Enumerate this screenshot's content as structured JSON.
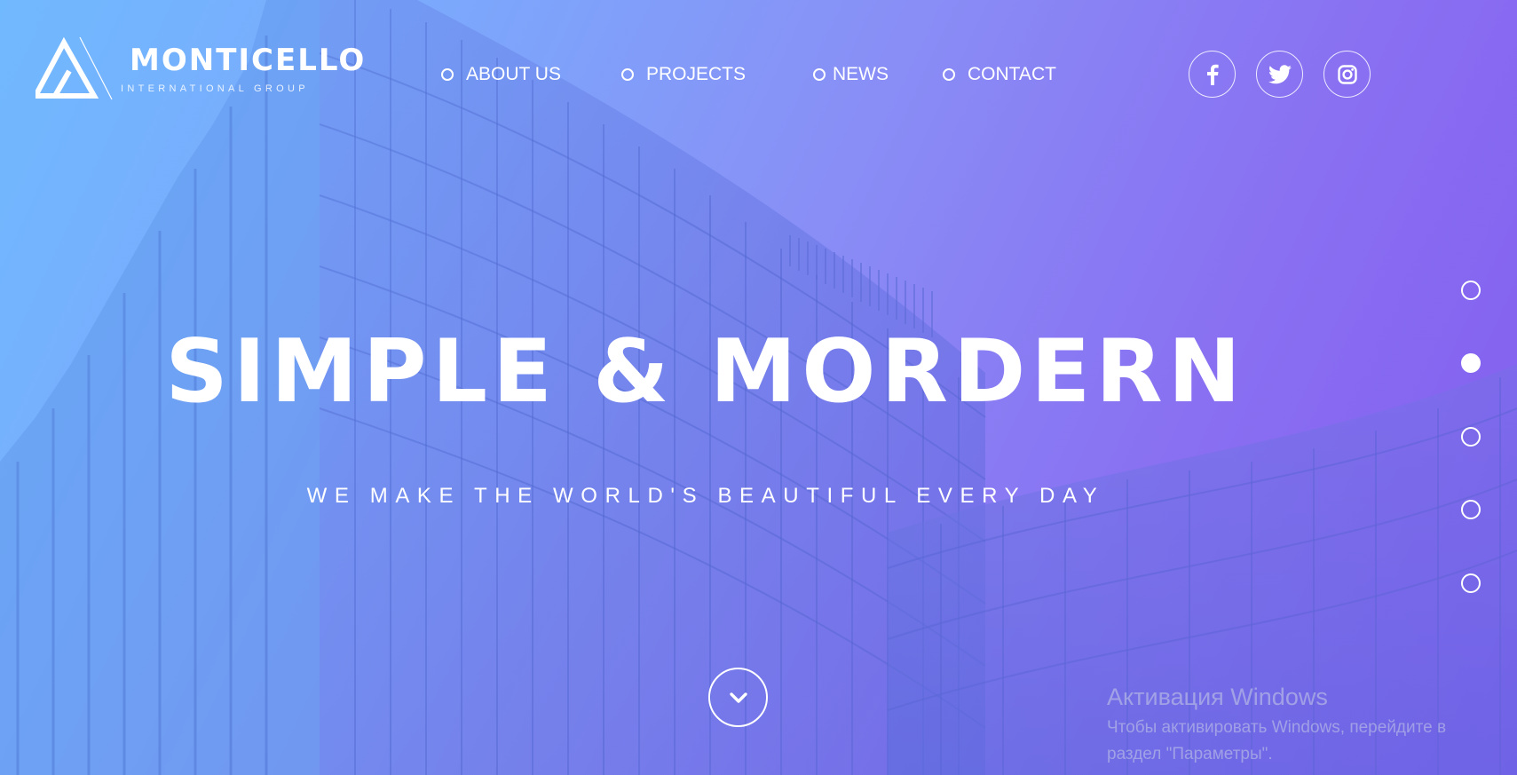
{
  "brand": {
    "name": "MONTICELLO",
    "subtitle": "INTERNATIONAL GROUP"
  },
  "nav": {
    "items": [
      {
        "label": "ABOUT US"
      },
      {
        "label": "PROJECTS"
      },
      {
        "label": "NEWS"
      },
      {
        "label": "CONTACT"
      }
    ]
  },
  "social": [
    {
      "icon": "facebook-icon"
    },
    {
      "icon": "twitter-icon"
    },
    {
      "icon": "instagram-icon"
    }
  ],
  "hero": {
    "headline": "SIMPLE & MORDERN",
    "tagline": "WE MAKE THE WORLD'S BEAUTIFUL EVERY DAY",
    "scroll_icon": "chevron-down-icon"
  },
  "pager": {
    "count": 5,
    "active_index": 1
  },
  "watermark": {
    "title": "Активация Windows",
    "line1": "Чтобы активировать Windows, перейдите в",
    "line2": "раздел \"Параметры\"."
  },
  "colors": {
    "gradient_left": "#72b9ff",
    "gradient_right": "#7f5cef",
    "text": "#ffffff"
  }
}
